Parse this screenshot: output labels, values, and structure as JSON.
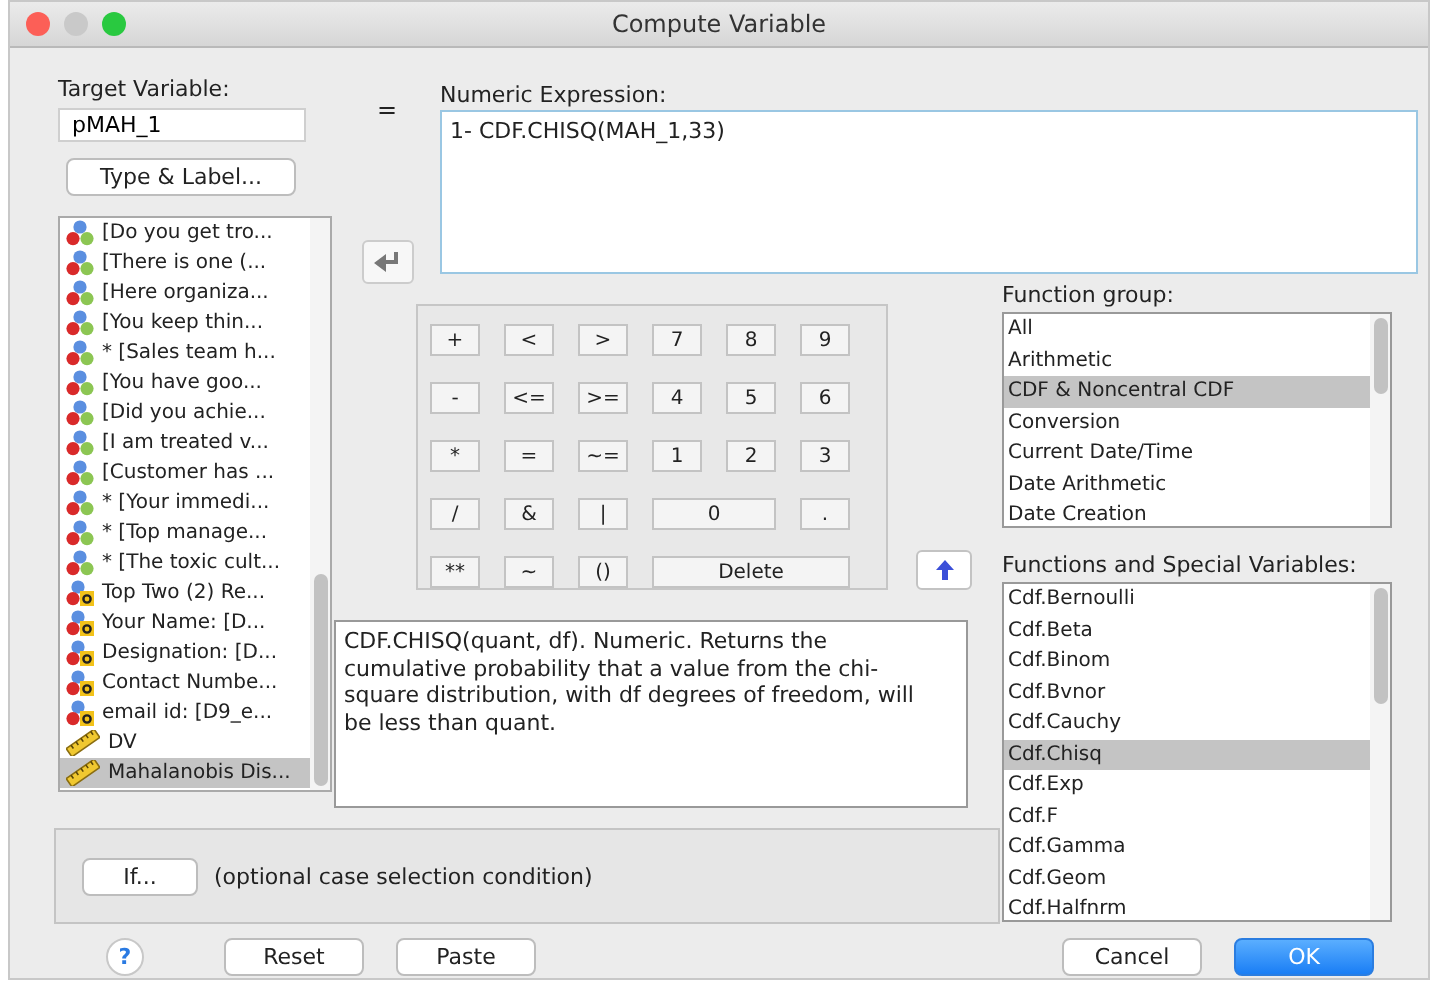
{
  "window": {
    "title": "Compute Variable"
  },
  "target_variable": {
    "label": "Target Variable:",
    "value": "pMAH_1"
  },
  "type_label_button": "Type & Label...",
  "equals": "=",
  "variables": [
    {
      "name": "[Do you get tro...",
      "kind": "nominal",
      "selected": false
    },
    {
      "name": "[There is one (...",
      "kind": "nominal",
      "selected": false
    },
    {
      "name": "[Here organiza...",
      "kind": "nominal",
      "selected": false
    },
    {
      "name": "[You keep thin...",
      "kind": "nominal",
      "selected": false
    },
    {
      "name": "* [Sales team h...",
      "kind": "nominal",
      "selected": false
    },
    {
      "name": "[You have goo...",
      "kind": "nominal",
      "selected": false
    },
    {
      "name": "[Did you achie...",
      "kind": "nominal",
      "selected": false
    },
    {
      "name": "[I am treated v...",
      "kind": "nominal",
      "selected": false
    },
    {
      "name": "[Customer has ...",
      "kind": "nominal",
      "selected": false
    },
    {
      "name": "* [Your immedi...",
      "kind": "nominal",
      "selected": false
    },
    {
      "name": "* [Top manage...",
      "kind": "nominal",
      "selected": false
    },
    {
      "name": "* [The toxic cult...",
      "kind": "nominal",
      "selected": false
    },
    {
      "name": "Top Two (2) Re...",
      "kind": "string",
      "selected": false
    },
    {
      "name": "Your Name: [D...",
      "kind": "string",
      "selected": false
    },
    {
      "name": "Designation: [D...",
      "kind": "string",
      "selected": false
    },
    {
      "name": "Contact Numbe...",
      "kind": "string",
      "selected": false
    },
    {
      "name": "email id: [D9_e...",
      "kind": "string",
      "selected": false
    },
    {
      "name": "DV",
      "kind": "scale",
      "selected": false
    },
    {
      "name": "Mahalanobis Dis...",
      "kind": "scale",
      "selected": true
    }
  ],
  "numeric_expression": {
    "label": "Numeric Expression:",
    "value": "1- CDF.CHISQ(MAH_1,33)"
  },
  "keypad": [
    {
      "label": "+",
      "kind": "key"
    },
    {
      "label": "<",
      "kind": "key"
    },
    {
      "label": ">",
      "kind": "key"
    },
    {
      "label": "7",
      "kind": "key"
    },
    {
      "label": "8",
      "kind": "key"
    },
    {
      "label": "9",
      "kind": "key"
    },
    {
      "label": "-",
      "kind": "key"
    },
    {
      "label": "<=",
      "kind": "key"
    },
    {
      "label": ">=",
      "kind": "key"
    },
    {
      "label": "4",
      "kind": "key"
    },
    {
      "label": "5",
      "kind": "key"
    },
    {
      "label": "6",
      "kind": "key"
    },
    {
      "label": "*",
      "kind": "key"
    },
    {
      "label": "=",
      "kind": "key"
    },
    {
      "label": "~=",
      "kind": "key"
    },
    {
      "label": "1",
      "kind": "key"
    },
    {
      "label": "2",
      "kind": "key"
    },
    {
      "label": "3",
      "kind": "key"
    },
    {
      "label": "/",
      "kind": "key"
    },
    {
      "label": "&",
      "kind": "key"
    },
    {
      "label": "|",
      "kind": "key"
    },
    {
      "label": "0",
      "kind": "double"
    },
    {
      "label": ".",
      "kind": "key"
    },
    {
      "label": "**",
      "kind": "key"
    },
    {
      "label": "~",
      "kind": "key"
    },
    {
      "label": "()",
      "kind": "key"
    },
    {
      "label": "Delete",
      "kind": "triple"
    }
  ],
  "description": "CDF.CHISQ(quant, df). Numeric. Returns the cumulative probability that a value from the chi-square distribution, with df degrees of freedom, will be less than quant.",
  "function_group": {
    "label": "Function group:",
    "items": [
      {
        "label": "All",
        "selected": false
      },
      {
        "label": "Arithmetic",
        "selected": false
      },
      {
        "label": "CDF & Noncentral CDF",
        "selected": true
      },
      {
        "label": "Conversion",
        "selected": false
      },
      {
        "label": "Current Date/Time",
        "selected": false
      },
      {
        "label": "Date Arithmetic",
        "selected": false
      },
      {
        "label": "Date Creation",
        "selected": false
      }
    ]
  },
  "functions": {
    "label": "Functions and Special Variables:",
    "items": [
      {
        "label": "Cdf.Bernoulli",
        "selected": false
      },
      {
        "label": "Cdf.Beta",
        "selected": false
      },
      {
        "label": "Cdf.Binom",
        "selected": false
      },
      {
        "label": "Cdf.Bvnor",
        "selected": false
      },
      {
        "label": "Cdf.Cauchy",
        "selected": false
      },
      {
        "label": "Cdf.Chisq",
        "selected": true
      },
      {
        "label": "Cdf.Exp",
        "selected": false
      },
      {
        "label": "Cdf.F",
        "selected": false
      },
      {
        "label": "Cdf.Gamma",
        "selected": false
      },
      {
        "label": "Cdf.Geom",
        "selected": false
      },
      {
        "label": "Cdf.Halfnrm",
        "selected": false
      }
    ]
  },
  "if_button": "If...",
  "if_note": "(optional case selection condition)",
  "help": "?",
  "buttons": [
    {
      "label": "Reset"
    },
    {
      "label": "Paste"
    }
  ],
  "actions": [
    {
      "label": "Cancel",
      "kind": "normal"
    },
    {
      "label": "OK",
      "kind": "default"
    }
  ]
}
